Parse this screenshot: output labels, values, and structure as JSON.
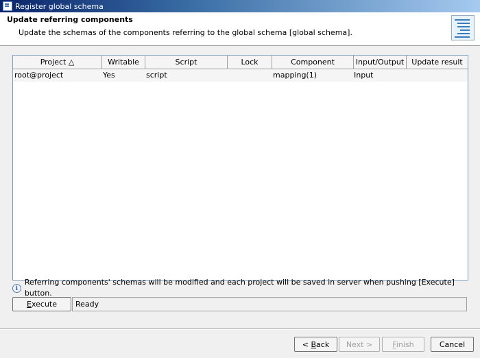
{
  "window": {
    "title": "Register global schema"
  },
  "header": {
    "title": "Update referring components",
    "description": "Update the schemas of the components referring to the global schema [global schema]."
  },
  "table": {
    "columns": [
      "Project △",
      "Writable",
      "Script",
      "Lock",
      "Component",
      "Input/Output",
      "Update result"
    ],
    "rows": [
      {
        "project": "root@project",
        "writable": "Yes",
        "script": "script",
        "lock": "",
        "component": "mapping(1)",
        "io": "Input",
        "result": ""
      }
    ]
  },
  "info_text": "Referring components' schemas will be modified and each project will be saved in server when pushing [Execute] button.",
  "execute": {
    "mnemonic": "E",
    "rest": "xecute"
  },
  "status": "Ready",
  "footer": {
    "back": {
      "prefix": "< ",
      "mnemonic": "B",
      "rest": "ack"
    },
    "next": "Next >",
    "finish": {
      "mnemonic": "F",
      "rest": "inish"
    },
    "cancel": "Cancel"
  },
  "icons": {
    "app": "app-window-icon",
    "banner": "schema-tree-icon",
    "info": "info-icon"
  }
}
